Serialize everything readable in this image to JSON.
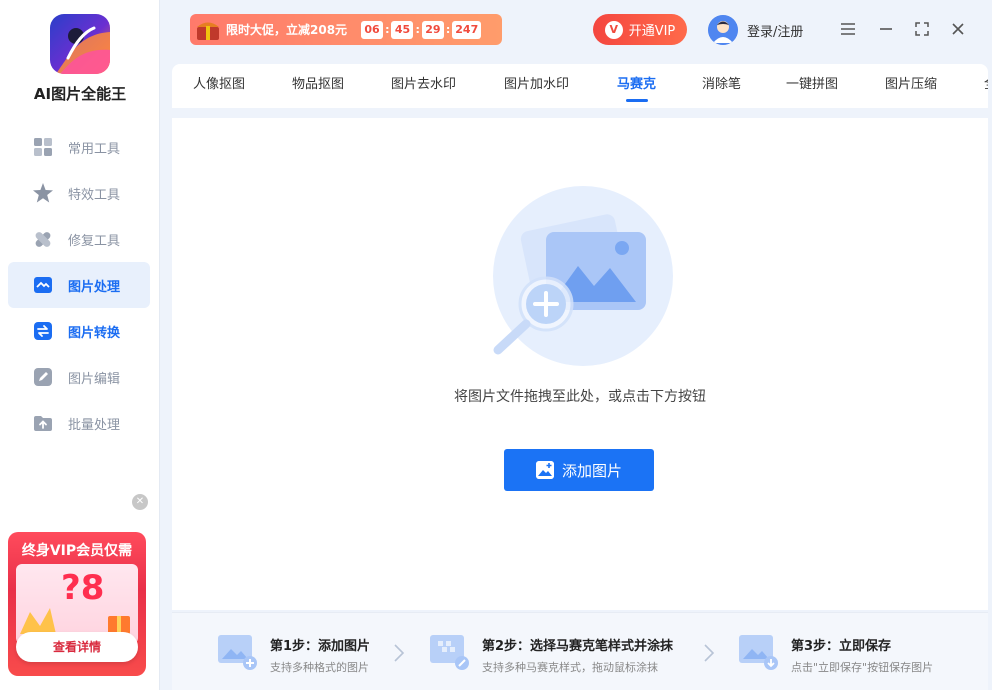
{
  "app": {
    "title": "AI图片全能王"
  },
  "sidebar": {
    "items": [
      {
        "label": "常用工具",
        "icon": "grid-icon"
      },
      {
        "label": "特效工具",
        "icon": "star-icon"
      },
      {
        "label": "修复工具",
        "icon": "bandage-icon"
      },
      {
        "label": "图片处理",
        "icon": "image-process-icon"
      },
      {
        "label": "图片转换",
        "icon": "convert-icon"
      },
      {
        "label": "图片编辑",
        "icon": "edit-icon"
      },
      {
        "label": "批量处理",
        "icon": "batch-upload-icon"
      }
    ],
    "active_index": 3
  },
  "promo": {
    "title": "终身VIP会员仅需",
    "price": "?8",
    "button": "查看详情"
  },
  "header": {
    "sale_text": "限时大促，立减208元",
    "countdown": [
      "06",
      "45",
      "29",
      "247"
    ],
    "vip_button": "开通VIP",
    "vip_icon": "V",
    "login": "登录/注册"
  },
  "tabs": [
    "人像抠图",
    "物品抠图",
    "图片去水印",
    "图片加水印",
    "马赛克",
    "消除笔",
    "一键拼图",
    "图片压缩",
    "全"
  ],
  "active_tab": 4,
  "main": {
    "hint": "将图片文件拖拽至此处，或点击下方按钮",
    "add_button": "添加图片"
  },
  "steps": [
    {
      "title": "第1步：添加图片",
      "desc": "支持多种格式的图片"
    },
    {
      "title": "第2步：选择马赛克笔样式并涂抹",
      "desc": "支持多种马赛克样式，拖动鼠标涂抹"
    },
    {
      "title": "第3步：立即保存",
      "desc": "点击\"立即保存\"按钮保存图片"
    }
  ],
  "colors": {
    "accent": "#1b73f5",
    "active_nav_bg": "#e8f0fc",
    "vip_red": "#f4463f"
  }
}
